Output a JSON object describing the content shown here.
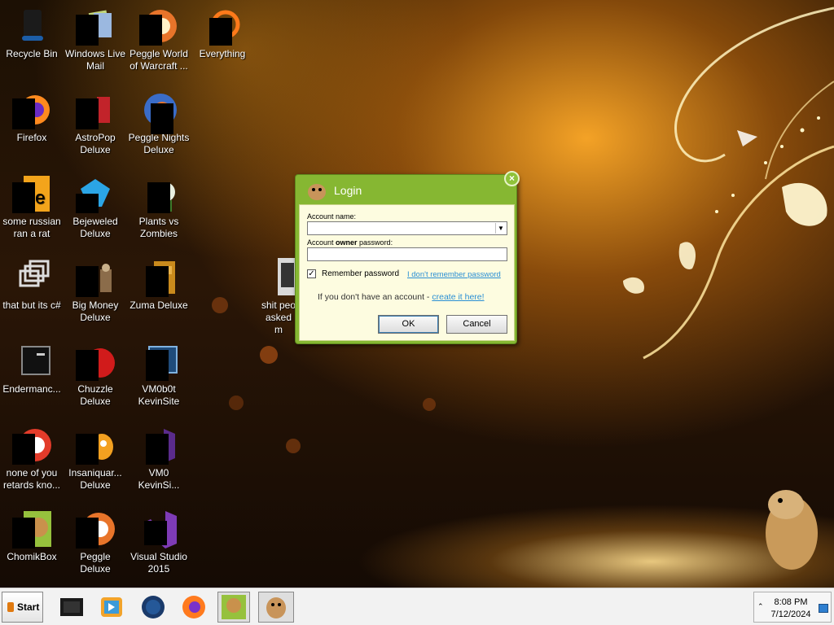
{
  "desktop": {
    "icons": [
      {
        "label": "Recycle Bin",
        "icon": "recycle-bin-icon"
      },
      {
        "label": "Windows Live Mail",
        "icon": "mail-icon"
      },
      {
        "label": "Peggle World of Warcraft ...",
        "icon": "peggle-icon"
      },
      {
        "label": "Everything",
        "icon": "everything-search-icon"
      },
      {
        "label": "Firefox",
        "icon": "firefox-icon"
      },
      {
        "label": "AstroPop Deluxe",
        "icon": "astropop-icon"
      },
      {
        "label": "Peggle Nights Deluxe",
        "icon": "peggle-nights-icon"
      },
      {
        "label": "some russian ran a rat",
        "icon": "java-file-icon"
      },
      {
        "label": "Bejeweled Deluxe",
        "icon": "bejeweled-icon"
      },
      {
        "label": "Plants vs Zombies",
        "icon": "plants-vs-zombies-icon"
      },
      {
        "label": "that but its c#",
        "icon": "folder-stack-icon"
      },
      {
        "label": "Big Money Deluxe",
        "icon": "big-money-icon"
      },
      {
        "label": "Zuma Deluxe",
        "icon": "zuma-icon"
      },
      {
        "label": "shit peo asked m",
        "icon": "file-icon"
      },
      {
        "label": "Endermanc...",
        "icon": "terminal-icon"
      },
      {
        "label": "Chuzzle Deluxe",
        "icon": "chuzzle-icon"
      },
      {
        "label": "VM0b0t KevinSite",
        "icon": "vm-shortcut-icon"
      },
      {
        "label": "none of you retards kno...",
        "icon": "peggle-icon"
      },
      {
        "label": "Insaniquar... Deluxe",
        "icon": "insaniquarium-icon"
      },
      {
        "label": "VM0 KevinSi...",
        "icon": "visual-studio-icon"
      },
      {
        "label": "ChomikBox",
        "icon": "chomikbox-icon"
      },
      {
        "label": "Peggle Deluxe",
        "icon": "peggle-icon"
      },
      {
        "label": "Visual Studio 2015",
        "icon": "visual-studio-icon"
      }
    ]
  },
  "dialog": {
    "title": "Login",
    "account_label": "Account name:",
    "account_value": "",
    "password_label_pre": "Account ",
    "password_label_bold": "owner",
    "password_label_post": " password:",
    "password_value": "",
    "remember_label": "Remember password",
    "remember_checked": true,
    "checkmark": "✓",
    "forgot_link": "I don't remember password",
    "no_account_text": "If you don't have an account - ",
    "create_link": "create it here!",
    "ok_label": "OK",
    "cancel_label": "Cancel",
    "close_glyph": "×"
  },
  "taskbar": {
    "start_label": "Start",
    "time": "8:08 PM",
    "date": "7/12/2024",
    "tray_chevron": "⌃",
    "apps": [
      {
        "name": "terminal-app",
        "icon": "terminal-icon"
      },
      {
        "name": "media-player-app",
        "icon": "media-player-icon"
      },
      {
        "name": "globe-app",
        "icon": "globe-icon"
      },
      {
        "name": "firefox-app",
        "icon": "firefox-icon"
      },
      {
        "name": "chomikbox-app",
        "icon": "chomikbox-icon"
      },
      {
        "name": "hamster-app",
        "icon": "hamster-icon"
      }
    ]
  },
  "colors": {
    "dialog_green": "#86b732",
    "dialog_body": "#fdfce0",
    "link_blue": "#2a8fd4",
    "taskbar": "#f2f2f2"
  }
}
